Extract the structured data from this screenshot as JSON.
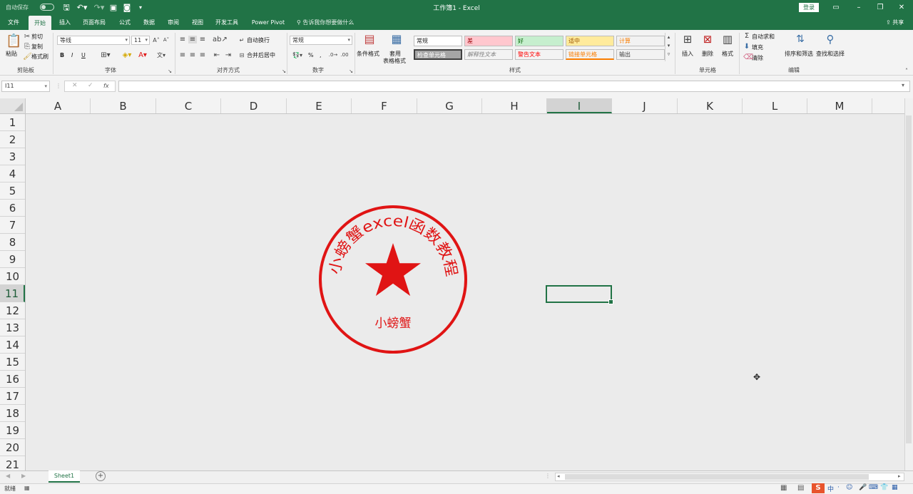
{
  "titlebar": {
    "autosave_label": "自动保存",
    "title": "工作簿1  -  Excel",
    "login": "登录"
  },
  "tabs": [
    "文件",
    "开始",
    "插入",
    "页面布局",
    "公式",
    "数据",
    "审阅",
    "视图",
    "开发工具",
    "Power Pivot"
  ],
  "active_tab": "开始",
  "tellme": "告诉我你想要做什么",
  "share": "共享",
  "ribbon": {
    "clipboard": {
      "paste": "粘贴",
      "cut": "剪切",
      "copy": "复制",
      "format_painter": "格式刷",
      "label": "剪贴板"
    },
    "font": {
      "name": "等线",
      "size": "11",
      "bold": "B",
      "italic": "I",
      "underline": "U",
      "label": "字体"
    },
    "align": {
      "wrap": "自动换行",
      "merge": "合并后居中",
      "label": "对齐方式"
    },
    "number": {
      "format": "常规",
      "percent": "%",
      "comma": ",",
      "label": "数字"
    },
    "styles": {
      "conditional": "条件格式",
      "table_format_1": "套用",
      "table_format_2": "表格格式",
      "cells": [
        {
          "text": "常规",
          "bg": "#ffffff",
          "fg": "#222222"
        },
        {
          "text": "差",
          "bg": "#ffc7ce",
          "fg": "#9c0006"
        },
        {
          "text": "好",
          "bg": "#c6efce",
          "fg": "#006100"
        },
        {
          "text": "适中",
          "bg": "#ffeb9c",
          "fg": "#9c5700"
        },
        {
          "text": "计算",
          "bg": "#f2f2f2",
          "fg": "#fa7d00"
        },
        {
          "text": "检查单元格",
          "bg": "#a5a5a5",
          "fg": "#ffffff"
        },
        {
          "text": "解释性文本",
          "bg": "#f3f3f3",
          "fg": "#7f7f7f"
        },
        {
          "text": "警告文本",
          "bg": "#f3f3f3",
          "fg": "#ff0000"
        },
        {
          "text": "链接单元格",
          "bg": "#f3f3f3",
          "fg": "#fa7d00"
        },
        {
          "text": "输出",
          "bg": "#f2f2f2",
          "fg": "#3f3f3f"
        }
      ],
      "label": "样式"
    },
    "cells": {
      "insert": "插入",
      "delete": "删除",
      "format": "格式",
      "label": "单元格"
    },
    "editing": {
      "autosum": "自动求和",
      "fill": "填充",
      "clear": "清除",
      "sort": "排序和筛选",
      "find": "查找和选择",
      "label": "编辑"
    }
  },
  "formula_bar": {
    "name_box": "I11",
    "fx": "fx",
    "cancel": "✕",
    "enter": "✓",
    "formula": ""
  },
  "columns": [
    "A",
    "B",
    "C",
    "D",
    "E",
    "F",
    "G",
    "H",
    "I",
    "J",
    "K",
    "L",
    "M"
  ],
  "selected_column": "I",
  "rows": [
    "1",
    "2",
    "3",
    "4",
    "5",
    "6",
    "7",
    "8",
    "9",
    "10",
    "11",
    "12",
    "13",
    "14",
    "15",
    "16",
    "17",
    "18",
    "19",
    "20",
    "21"
  ],
  "selected_row": "11",
  "stamp": {
    "arc_text": "小螃蟹excel函数教程",
    "bottom_text": "小螃蟹",
    "color": "#e01414"
  },
  "sheet_tab": "Sheet1",
  "add_sheet": "+",
  "status": "就绪",
  "ime": "中"
}
